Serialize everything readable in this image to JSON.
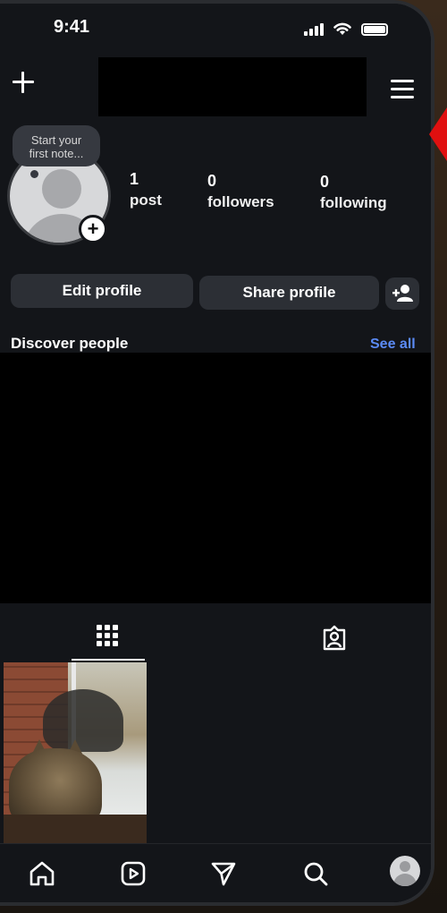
{
  "status_bar": {
    "time": "9:41"
  },
  "profile": {
    "note_prompt_line1": "Start your",
    "note_prompt_line2": "first note...",
    "add_badge": "+",
    "stats": [
      {
        "value": "1",
        "label": "post"
      },
      {
        "value": "0",
        "label": "followers"
      },
      {
        "value": "0",
        "label": "following"
      }
    ]
  },
  "actions": {
    "edit_profile": "Edit profile",
    "share_profile": "Share profile"
  },
  "discover": {
    "title": "Discover people",
    "see_all": "See all"
  },
  "icons": {
    "header_left": "plus-icon",
    "header_right": "menu-icon",
    "add_person": "add-person-icon",
    "tab_posts": "grid-icon",
    "tab_tagged": "tagged-icon",
    "nav": [
      "home-icon",
      "reels-icon",
      "direct-icon",
      "search-icon",
      "profile-avatar"
    ]
  },
  "colors": {
    "background": "#131519",
    "button": "#2c2f35",
    "link": "#5b8bf5",
    "annotation_arrow": "#e01010"
  }
}
